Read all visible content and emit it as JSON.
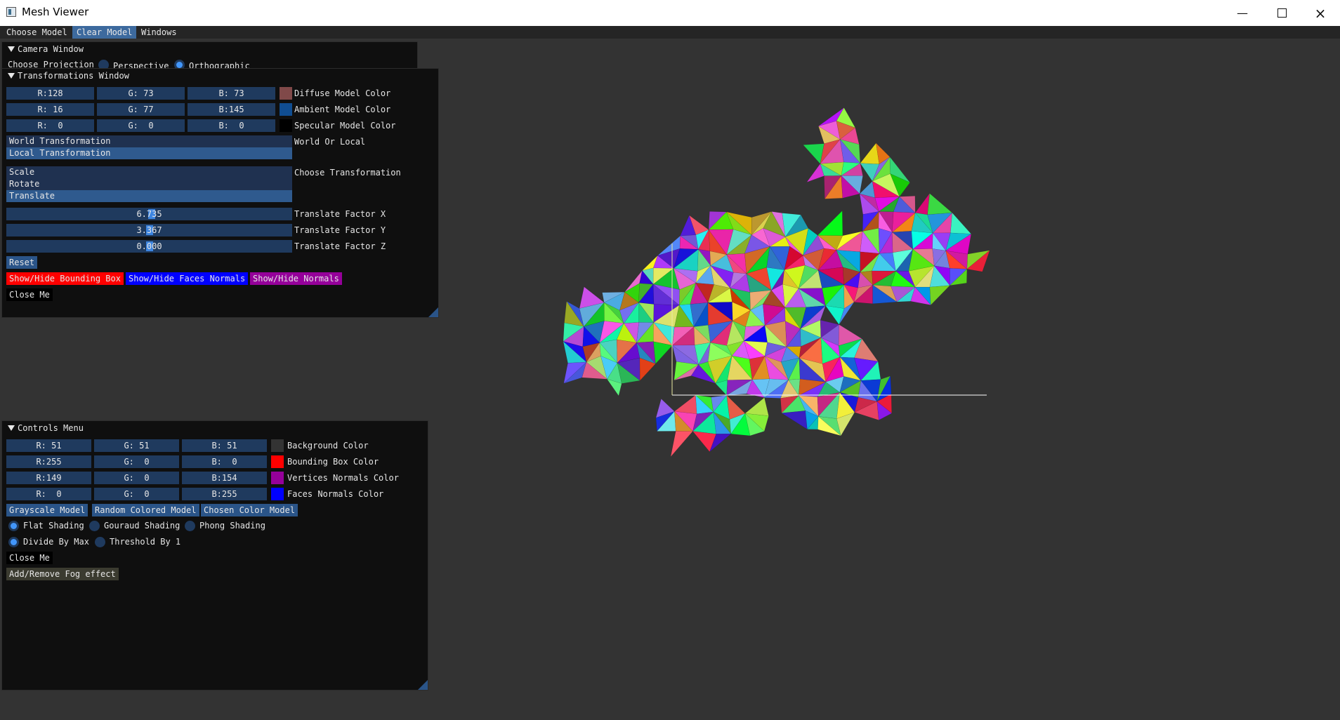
{
  "window": {
    "title": "Mesh Viewer"
  },
  "menubar": {
    "items": [
      "Choose Model",
      "Clear Model",
      "Windows"
    ]
  },
  "camera_window": {
    "title": "Camera Window",
    "projection_label": "Choose Projection",
    "options": [
      "Perspective",
      "Orthographic"
    ],
    "selected": "Orthographic"
  },
  "transformations_window": {
    "title": "Transformations Window",
    "color_rows": [
      {
        "r": "R:128",
        "g": "G: 73",
        "b": "B: 73",
        "color": "#804949",
        "label": "Diffuse Model Color"
      },
      {
        "r": "R: 16",
        "g": "G: 77",
        "b": "B:145",
        "color": "#104d91",
        "label": "Ambient Model Color"
      },
      {
        "r": "R:  0",
        "g": "G:  0",
        "b": "B:  0",
        "color": "#000000",
        "label": "Specular Model Color"
      }
    ],
    "space_options": [
      "World Transformation",
      "Local Transformation"
    ],
    "space_selected": "Local Transformation",
    "space_label": "World Or Local",
    "transform_options": [
      "Scale",
      "Rotate",
      "Translate"
    ],
    "transform_selected": "Translate",
    "transform_label": "Choose Transformation",
    "sliders": [
      {
        "value": "6.735",
        "fraction": 0.51,
        "label": "Translate Factor X"
      },
      {
        "value": "3.367",
        "fraction": 0.5,
        "label": "Translate Factor Y"
      },
      {
        "value": "0.000",
        "fraction": 0.5,
        "label": "Translate Factor Z"
      }
    ],
    "reset_label": "Reset",
    "toggle_buttons": [
      {
        "label": "Show/Hide Bounding Box",
        "color": "#ff0000"
      },
      {
        "label": "Show/Hide Faces Normals",
        "color": "#0000ff"
      },
      {
        "label": "Show/Hide Normals",
        "color": "#95009a"
      }
    ],
    "close_label": "Close Me"
  },
  "controls_window": {
    "title": "Controls Menu",
    "color_rows": [
      {
        "r": "R: 51",
        "g": "G: 51",
        "b": "B: 51",
        "color": "#333333",
        "label": "Background Color"
      },
      {
        "r": "R:255",
        "g": "G:  0",
        "b": "B:  0",
        "color": "#ff0000",
        "label": "Bounding Box Color"
      },
      {
        "r": "R:149",
        "g": "G:  0",
        "b": "B:154",
        "color": "#95009a",
        "label": "Vertices Normals Color"
      },
      {
        "r": "R:  0",
        "g": "G:  0",
        "b": "B:255",
        "color": "#0000ff",
        "label": "Faces Normals Color"
      }
    ],
    "model_buttons": [
      "Grayscale Model",
      "Random Colored Model",
      "Chosen Color Model"
    ],
    "shading_options": [
      "Flat Shading",
      "Gouraud Shading",
      "Phong Shading"
    ],
    "shading_selected": "Flat Shading",
    "normalize_options": [
      "Divide By Max",
      "Threshold By 1"
    ],
    "normalize_selected": "Divide By Max",
    "close_label": "Close Me",
    "fog_label": "Add/Remove Fog effect"
  },
  "colors": {
    "accent": "#4296fa",
    "frame_bg": "#1f3a5e",
    "button": "#2a5488",
    "viewport_bg": "#333333"
  }
}
